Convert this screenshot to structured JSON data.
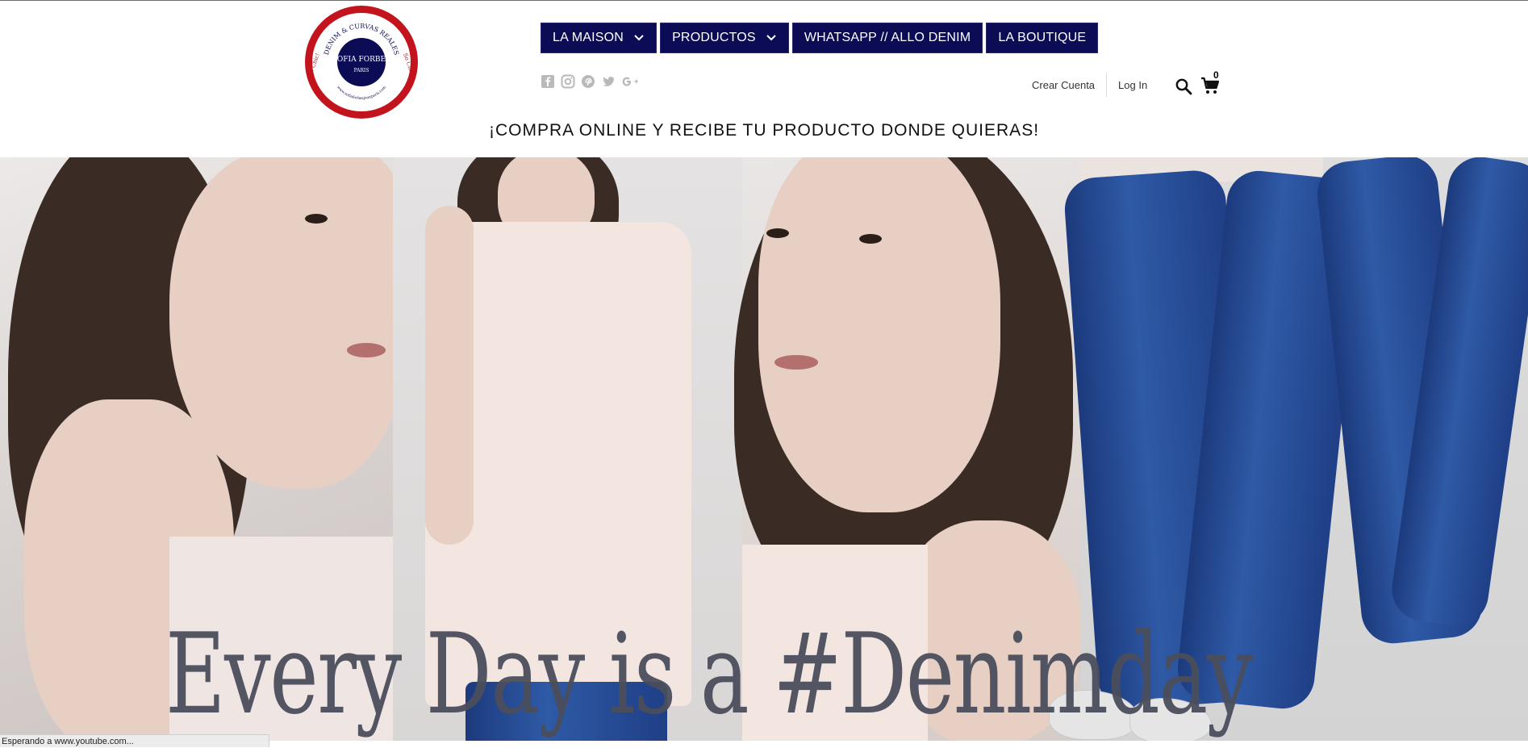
{
  "brand": {
    "logo_ring_text": "DENIM & CURVAS REALES",
    "logo_name": "SOFIA FORBES",
    "logo_city": "PARIS",
    "logo_side_left": "So Chic!",
    "logo_side_right": "So Chic!",
    "logo_url": "www.sofiaforbesjeanparis.com",
    "colors": {
      "red": "#c3141d",
      "navy": "#0c0b56"
    }
  },
  "nav": {
    "items": [
      {
        "label": "LA MAISON",
        "has_dropdown": true
      },
      {
        "label": "PRODUCTOS",
        "has_dropdown": true
      },
      {
        "label": "WHATSAPP // ALLO DENIM",
        "has_dropdown": false
      },
      {
        "label": "LA BOUTIQUE",
        "has_dropdown": false
      }
    ]
  },
  "social": [
    "facebook-icon",
    "instagram-icon",
    "pinterest-icon",
    "twitter-icon",
    "google-plus-icon"
  ],
  "account": {
    "create_label": "Crear Cuenta",
    "login_label": "Log In",
    "cart_count": "0"
  },
  "promo": {
    "text": "¡COMPRA ONLINE Y RECIBE TU PRODUCTO DONDE QUIERAS!"
  },
  "hero": {
    "tagline": "Every Day is a #Denimday"
  },
  "status_bar": {
    "text": "Esperando a www.youtube.com..."
  }
}
